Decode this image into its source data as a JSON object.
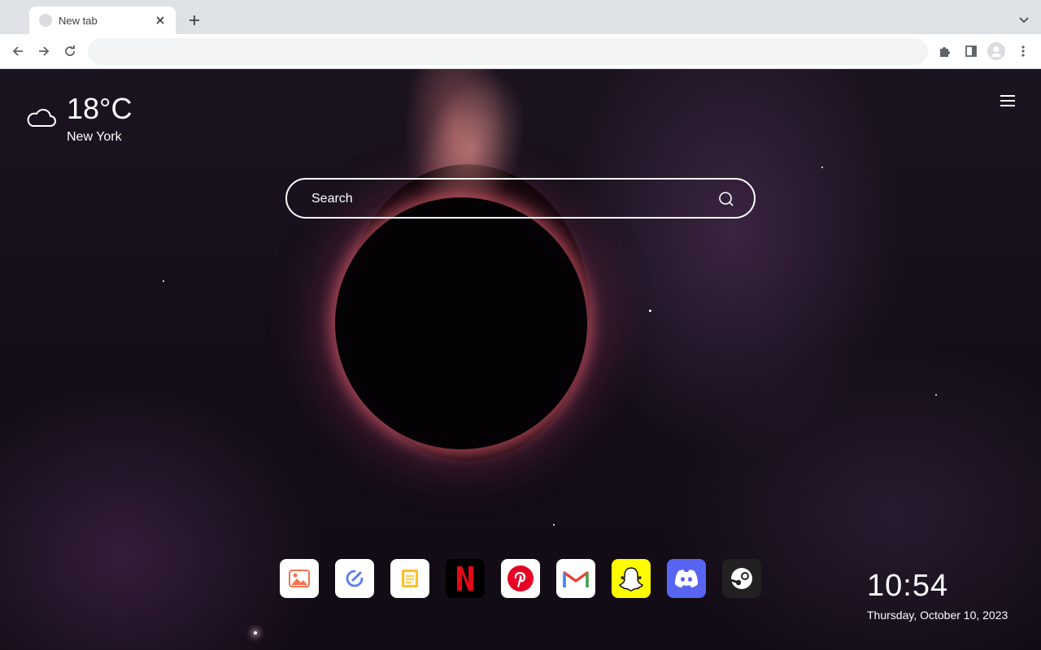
{
  "browser": {
    "tab_title": "New tab",
    "address": "",
    "icons": [
      "back-icon",
      "forward-icon",
      "reload-icon",
      "extensions-icon",
      "side-panel-icon",
      "profile-icon",
      "more-icon",
      "tab-search-icon",
      "close-icon",
      "plus-icon"
    ]
  },
  "weather": {
    "temperature": "18°C",
    "city": "New York",
    "icon": "cloud-icon"
  },
  "search": {
    "placeholder": "Search"
  },
  "dock": {
    "apps": [
      "Photos",
      "Pencil",
      "Notes",
      "Netflix",
      "Pinterest",
      "Gmail",
      "Snapchat",
      "Discord",
      "Steam"
    ]
  },
  "clock": {
    "time": "10:54",
    "date": "Thursday, October 10, 2023"
  },
  "colors": {
    "tabstrip": "#dee1e6",
    "toolbar": "#ffffff",
    "omnibox": "#f1f3f4",
    "page_bg": "#150e19",
    "glow": "#ff7878",
    "netflix_red": "#e50914",
    "pinterest_red": "#e60023",
    "snapchat_yellow": "#fffc00",
    "discord_blurple": "#5865f2",
    "steam_dark": "#1b2838"
  }
}
